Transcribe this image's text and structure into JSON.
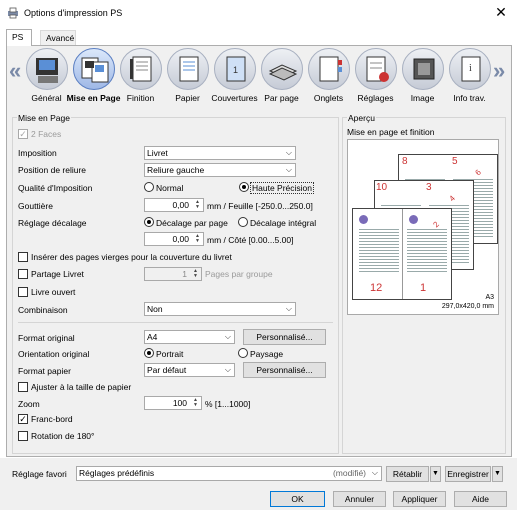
{
  "window": {
    "title": "Options d'impression PS",
    "close": "✕"
  },
  "tabs": {
    "ps": "PS",
    "avance": "Avancé"
  },
  "strip": {
    "left_arrow": "«",
    "right_arrow": "»",
    "items": [
      "Général",
      "Mise en Page",
      "Finition",
      "Papier",
      "Couvertures",
      "Par page",
      "Onglets",
      "Réglages",
      "Image",
      "Info trav."
    ]
  },
  "layout": {
    "group_title": "Mise en Page",
    "two_faces": "2 Faces",
    "imposition_label": "Imposition",
    "imposition_value": "Livret",
    "binding_label": "Position de reliure",
    "binding_value": "Reliure gauche",
    "quality_label": "Qualité d'Imposition",
    "quality_normal": "Normal",
    "quality_high": "Haute Précision",
    "gutter_label": "Gouttière",
    "gutter_value": "0,00",
    "gutter_unit": "mm / Feuille [-250.0...250.0]",
    "shift_label": "Réglage décalage",
    "shift_page": "Décalage par page",
    "shift_integral": "Décalage intégral",
    "shift_value": "0,00",
    "shift_unit": "mm / Côté [0.00...5.00]",
    "insert_blank": "Insérer des pages vierges pour la couverture du livret",
    "split_booklet": "Partage Livret",
    "split_value": "1",
    "split_unit": "Pages par groupe",
    "open_book": "Livre ouvert",
    "combine_label": "Combinaison",
    "combine_value": "Non",
    "orig_format_label": "Format original",
    "orig_format_value": "A4",
    "custom1": "Personnalisé...",
    "orient_label": "Orientation original",
    "portrait": "Portrait",
    "landscape": "Paysage",
    "paper_format_label": "Format papier",
    "paper_format_value": "Par défaut",
    "custom2": "Personnalisé...",
    "fit_paper": "Ajuster à la taille de papier",
    "zoom_label": "Zoom",
    "zoom_value": "100",
    "zoom_unit": "% [1...1000]",
    "edge": "Franc-bord",
    "rotate": "Rotation de 180°"
  },
  "preview": {
    "group_title": "Aperçu",
    "subtitle": "Mise en page et finition",
    "paper": "A3",
    "dims": "297,0x420,0 mm",
    "pages": [
      "8",
      "5",
      "6",
      "10",
      "3",
      "4",
      "12",
      "1",
      "2"
    ]
  },
  "footer": {
    "fav_label": "Réglage favori",
    "fav_value": "Réglages prédéfinis",
    "fav_state": "(modifié)",
    "restore": "Rétablir",
    "save": "Enregistrer",
    "ok": "OK",
    "cancel": "Annuler",
    "apply": "Appliquer",
    "help": "Aide"
  }
}
